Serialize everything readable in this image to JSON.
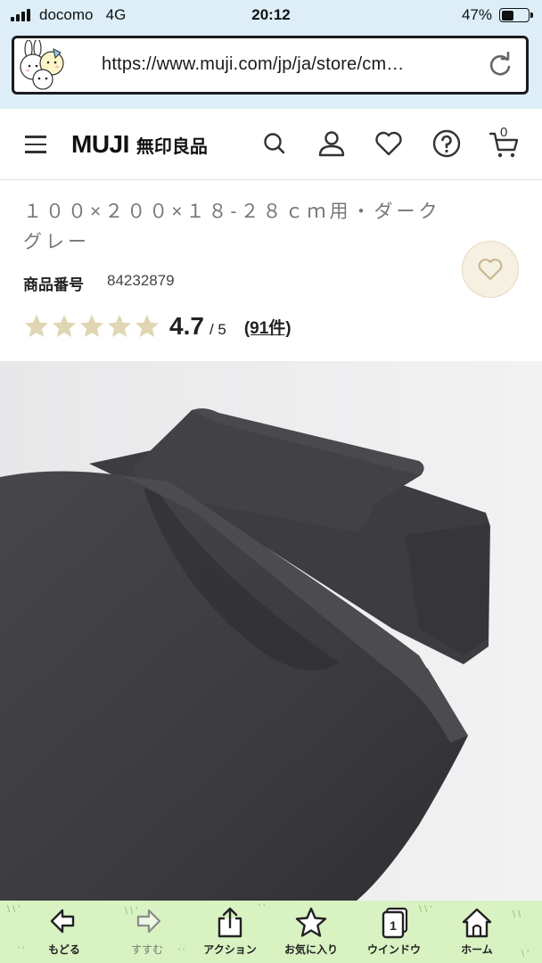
{
  "status_bar": {
    "carrier": "docomo",
    "network": "4G",
    "time": "20:12",
    "battery_percent": "47%",
    "battery_level": 0.47
  },
  "browser": {
    "url": "https://www.muji.com/jp/ja/store/cm…",
    "mascot_icon": "mascot-avatar-icon",
    "reload_icon": "reload-icon"
  },
  "site_header": {
    "logo_en": "MUJI",
    "logo_ja": "無印良品",
    "icons": [
      "menu-icon",
      "search-icon",
      "account-icon",
      "favorite-icon",
      "help-icon",
      "cart-icon"
    ],
    "cart_count": "0"
  },
  "product": {
    "name": "１００×２００×１８-２８ｃｍ用・ダークグレー",
    "sku_label": "商品番号",
    "sku_value": "84232879",
    "rating_value": "4.7",
    "rating_max": "/ 5",
    "rating_numeric": 4.7,
    "review_count": "(91件)",
    "star_color": "#e0d6b4",
    "image_color": "#3c3c40"
  },
  "toolbar": {
    "items": [
      {
        "label": "もどる",
        "icon": "back-arrow-icon"
      },
      {
        "label": "すすむ",
        "icon": "forward-arrow-icon"
      },
      {
        "label": "アクション",
        "icon": "share-icon"
      },
      {
        "label": "お気に入り",
        "icon": "bookmark-star-icon"
      },
      {
        "label": "ウインドウ",
        "icon": "window-icon",
        "badge": "1"
      },
      {
        "label": "ホーム",
        "icon": "home-icon"
      }
    ]
  }
}
